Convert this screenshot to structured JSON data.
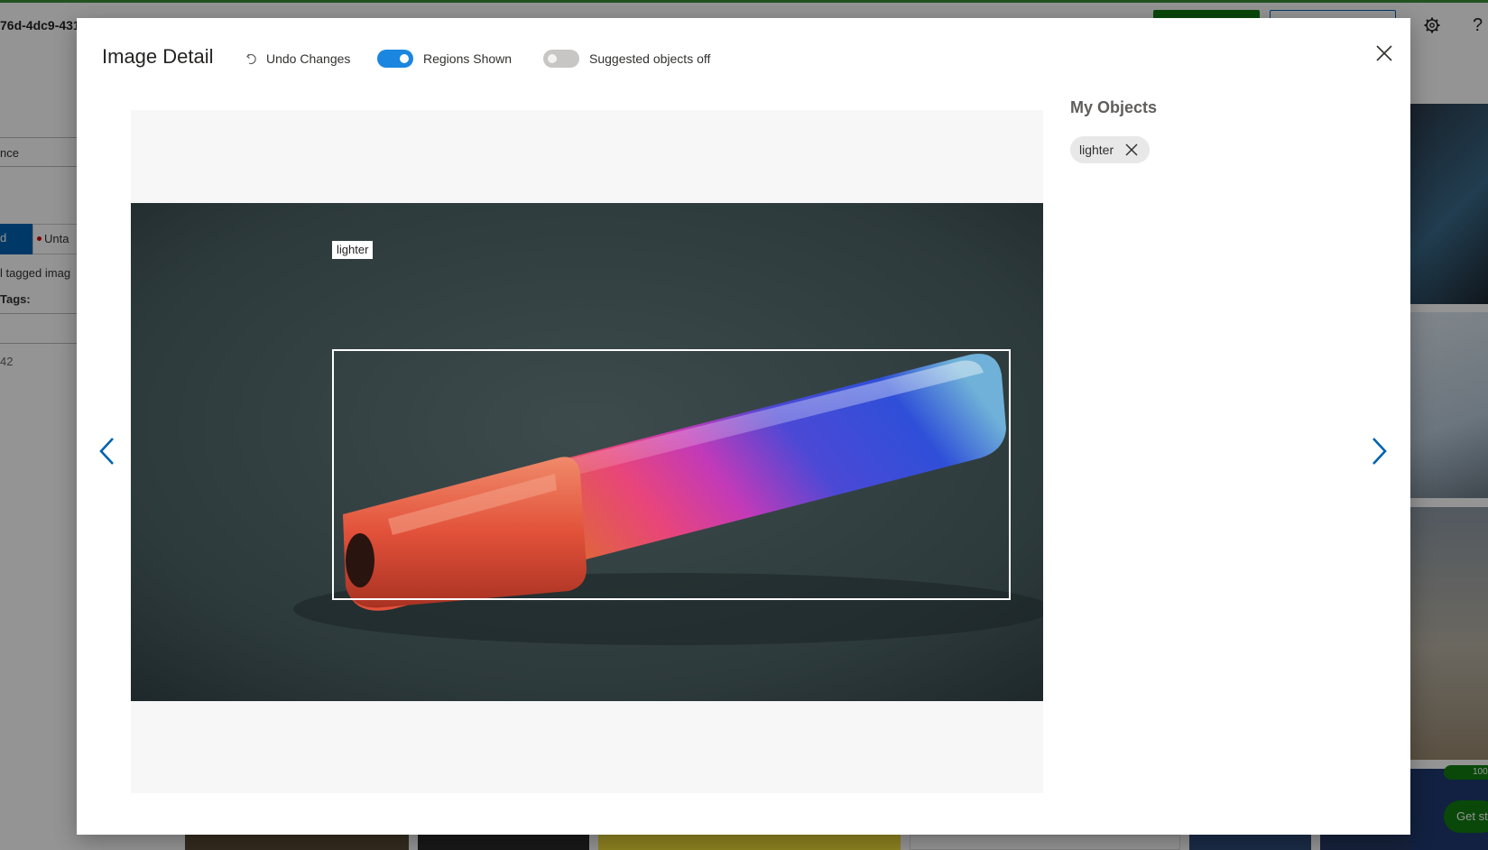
{
  "background": {
    "iteration_label": "76d-4dc9-431",
    "sidebar": {
      "filter_label": "nce",
      "tagged_tab": "d",
      "untagged_tab": "Unta",
      "tagged_images_text": "l tagged imag",
      "tags_heading": "Tags:",
      "count_text": "42"
    },
    "get_started_label": "Get st",
    "progress_count": "100"
  },
  "modal": {
    "title": "Image Detail",
    "undo_label": "Undo Changes",
    "regions_toggle": {
      "label": "Regions Shown",
      "on": true
    },
    "suggested_toggle": {
      "label": "Suggested objects off",
      "on": false
    },
    "accent_color": "#1a86e0",
    "region": {
      "tag": "lighter"
    },
    "my_objects": {
      "title": "My Objects",
      "tags": [
        "lighter"
      ]
    }
  }
}
